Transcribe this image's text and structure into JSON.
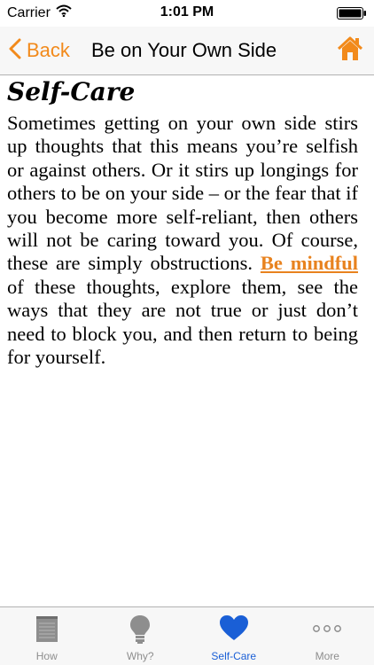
{
  "status_bar": {
    "carrier": "Carrier",
    "time": "1:01 PM",
    "wifi_icon": "wifi-icon",
    "battery_icon": "battery-icon"
  },
  "nav": {
    "back_label": "Back",
    "title": "Be on Your Own Side",
    "home_icon": "home-icon",
    "accent_color": "#f28a1b"
  },
  "content": {
    "title": "Self-Care",
    "text_before_link": "Sometimes getting on your own side stirs up thoughts that this means you’re selfish or against others. Or it stirs up longings for others to be on your side – or the fear that if you become more self-reliant, then others will not be caring toward you. Of course, these are simply obstructions. ",
    "link_text": "Be mindful",
    "text_after_link": " of these thoughts, explore them, see the ways that they are not true or just don’t need to block you, and then return to being for yourself."
  },
  "tabs": [
    {
      "label": "How",
      "icon": "notepad-icon",
      "active": false
    },
    {
      "label": "Why?",
      "icon": "lightbulb-icon",
      "active": false
    },
    {
      "label": "Self-Care",
      "icon": "heart-icon",
      "active": true
    },
    {
      "label": "More",
      "icon": "more-dots-icon",
      "active": false
    }
  ],
  "colors": {
    "tab_active": "#1a5fd6",
    "tab_inactive": "#8e8e8e",
    "link": "#e8821e"
  }
}
